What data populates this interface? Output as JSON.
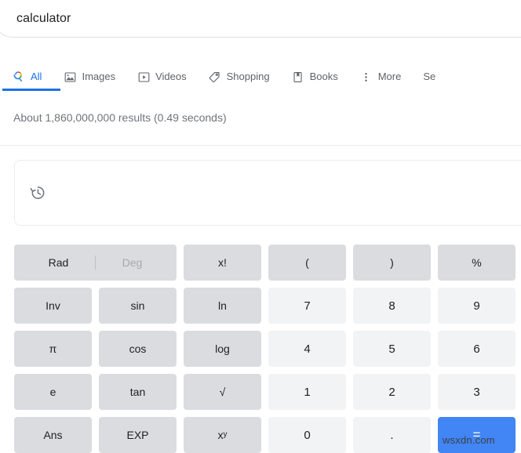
{
  "search": {
    "query": "calculator"
  },
  "tabs": [
    {
      "label": "All",
      "icon": "google-search-icon",
      "active": true
    },
    {
      "label": "Images",
      "icon": "image-icon",
      "active": false
    },
    {
      "label": "Videos",
      "icon": "video-play-icon",
      "active": false
    },
    {
      "label": "Shopping",
      "icon": "price-tag-icon",
      "active": false
    },
    {
      "label": "Books",
      "icon": "book-icon",
      "active": false
    },
    {
      "label": "More",
      "icon": "more-vertical-icon",
      "active": false
    },
    {
      "label": "Se",
      "icon": "none",
      "active": false
    }
  ],
  "results": {
    "count_text": "About 1,860,000,000 results (0.49 seconds)"
  },
  "calculator": {
    "display": {
      "history_icon": "history-icon",
      "value": ""
    },
    "angle_mode": {
      "rad_label": "Rad",
      "deg_label": "Deg",
      "selected": "Rad"
    },
    "keys": [
      {
        "label": "x!",
        "type": "func"
      },
      {
        "label": "(",
        "type": "func"
      },
      {
        "label": ")",
        "type": "func"
      },
      {
        "label": "%",
        "type": "func"
      },
      {
        "label": "Inv",
        "type": "func"
      },
      {
        "label": "sin",
        "type": "func"
      },
      {
        "label": "ln",
        "type": "func"
      },
      {
        "label": "7",
        "type": "num"
      },
      {
        "label": "8",
        "type": "num"
      },
      {
        "label": "9",
        "type": "num"
      },
      {
        "label": "π",
        "type": "func"
      },
      {
        "label": "cos",
        "type": "func"
      },
      {
        "label": "log",
        "type": "func"
      },
      {
        "label": "4",
        "type": "num"
      },
      {
        "label": "5",
        "type": "num"
      },
      {
        "label": "6",
        "type": "num"
      },
      {
        "label": "e",
        "type": "func"
      },
      {
        "label": "tan",
        "type": "func"
      },
      {
        "label": "√",
        "type": "func"
      },
      {
        "label": "1",
        "type": "num"
      },
      {
        "label": "2",
        "type": "num"
      },
      {
        "label": "3",
        "type": "num"
      },
      {
        "label": "Ans",
        "type": "func"
      },
      {
        "label": "EXP",
        "type": "func"
      },
      {
        "label": "xy",
        "type": "func",
        "superscript": "y",
        "base": "x"
      },
      {
        "label": "0",
        "type": "num"
      },
      {
        "label": ".",
        "type": "num"
      },
      {
        "label": "=",
        "type": "equals"
      }
    ]
  },
  "watermark": {
    "text": "wsxdn.com"
  },
  "colors": {
    "accent_blue": "#1a73e8",
    "equals_blue": "#4285f4",
    "func_key_bg": "#dadce0",
    "num_key_bg": "#f1f3f4",
    "text_primary": "#202124",
    "text_secondary": "#5f6368",
    "text_muted": "#70757a"
  }
}
